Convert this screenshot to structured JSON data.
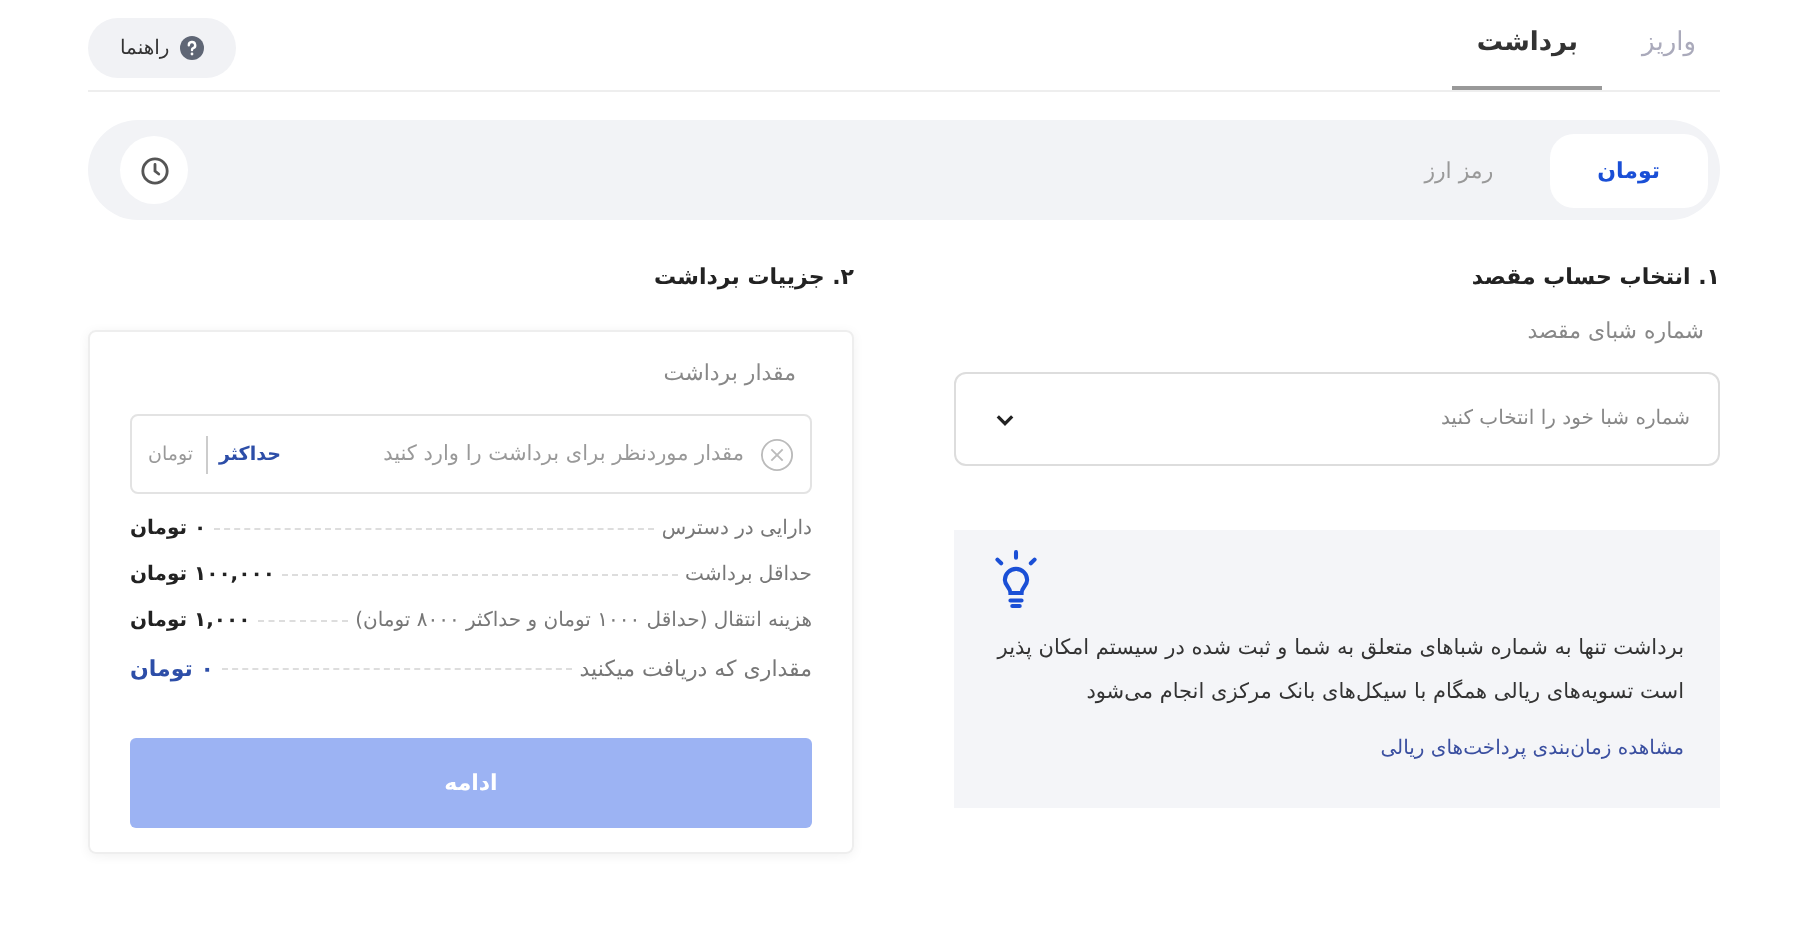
{
  "tabs": [
    {
      "label": "واریز",
      "selected": false
    },
    {
      "label": "برداشت",
      "selected": true
    }
  ],
  "help_button": {
    "label": "راهنما"
  },
  "currency_tabs": [
    {
      "label": "تومان",
      "selected": true
    },
    {
      "label": "رمز ارز",
      "selected": false
    }
  ],
  "destination": {
    "title": "۱. انتخاب حساب مقصد",
    "field_label": "شماره شبای مقصد",
    "select": {
      "placeholder": "شماره شبا خود را انتخاب کنید"
    }
  },
  "info": {
    "text": "برداشت تنها به شماره شباهای متعلق به شما و ثبت شده در سیستم امکان پذیر است تسویه‌های ریالی همگام با سیکل‌های بانک مرکزی انجام می‌شود",
    "link": "مشاهده زمان‌بندی پرداخت‌های ریالی"
  },
  "details": {
    "title": "۲. جزییات برداشت",
    "amount_label": "مقدار برداشت",
    "amount": {
      "placeholder": "مقدار موردنظر برای برداشت را وارد کنید",
      "max": "حداکثر",
      "unit": "تومان"
    },
    "rows": [
      {
        "label": "دارایی در دسترس",
        "value": "۰ تومان",
        "kind": "normal"
      },
      {
        "label": "حداقل برداشت",
        "value": "۱۰۰,۰۰۰ تومان",
        "kind": "normal"
      },
      {
        "label": "هزینه انتقال (حداقل ۱۰۰۰ تومان و حداکثر ۸۰۰۰ تومان)",
        "value": "۱,۰۰۰ تومان",
        "kind": "normal"
      },
      {
        "label": "مقداری که دریافت میکنید",
        "value": "۰ تومان",
        "kind": "total"
      }
    ],
    "submit": {
      "label": "ادامه",
      "disabled": true
    }
  }
}
